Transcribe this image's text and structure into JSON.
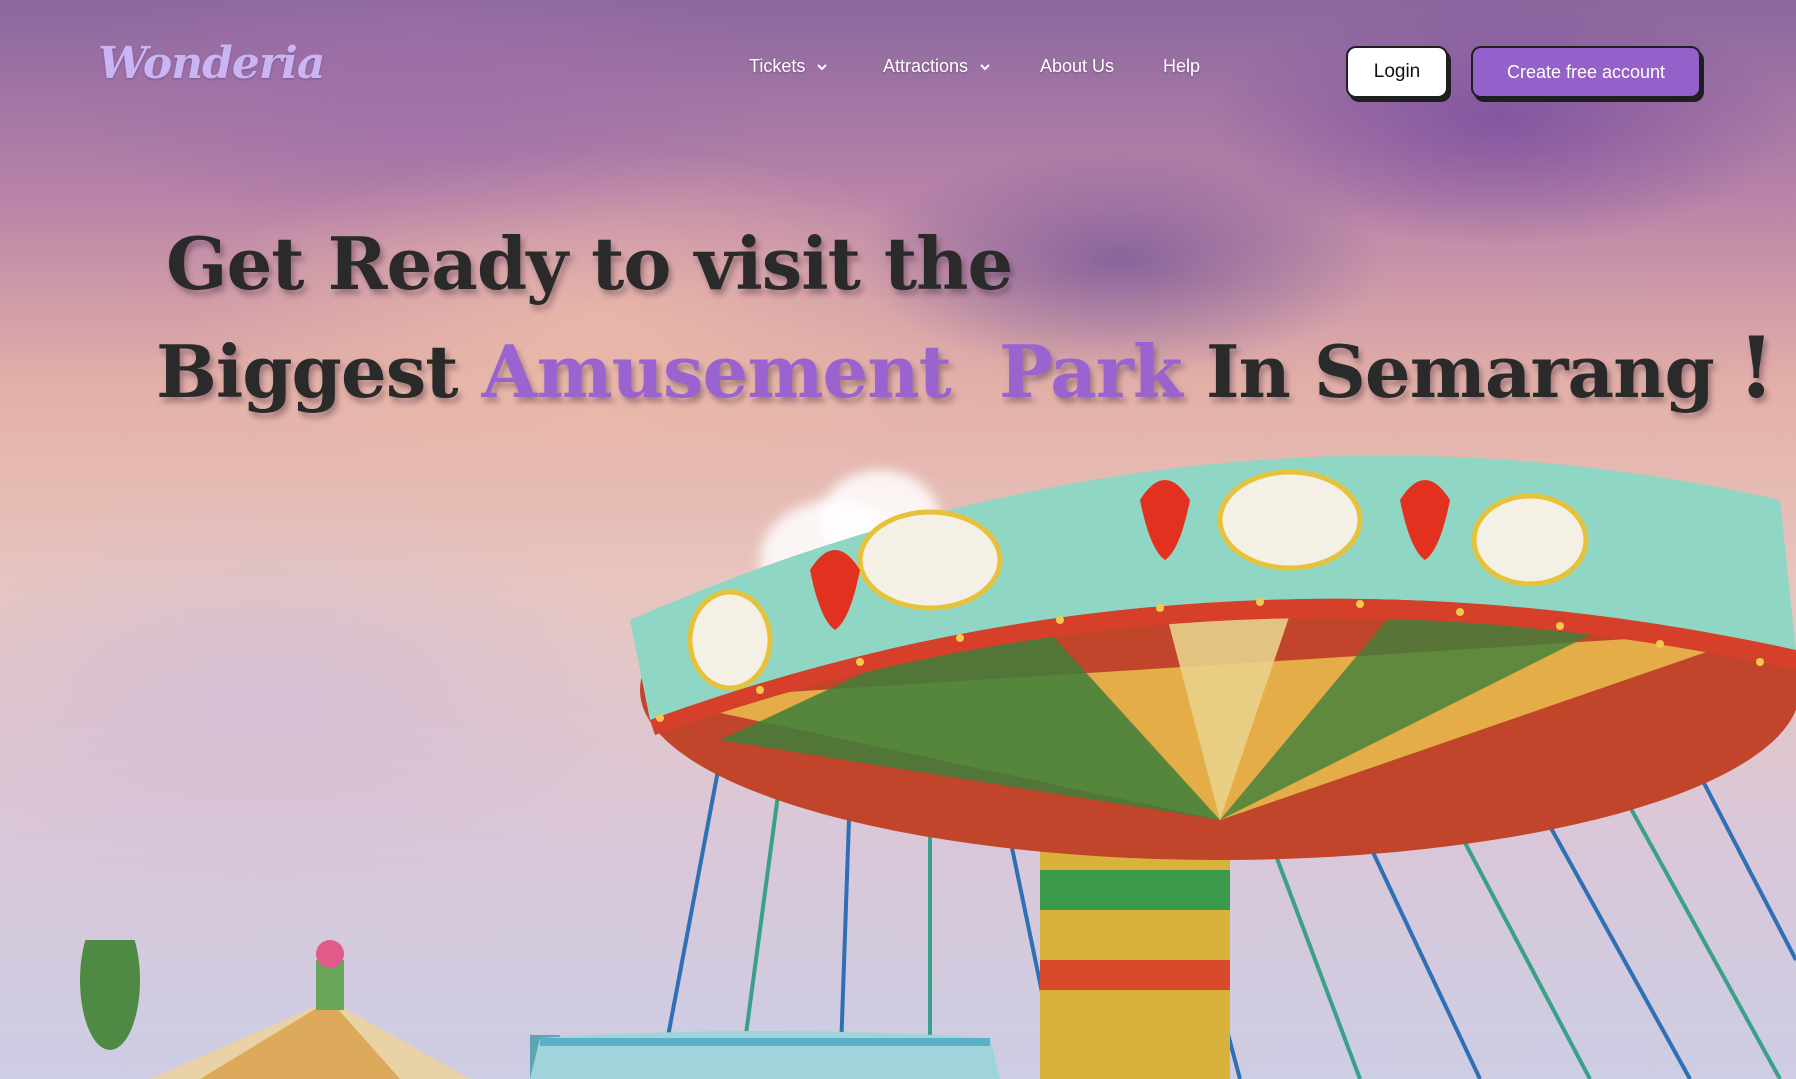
{
  "brand": {
    "logo_text": "Wonderia"
  },
  "nav": {
    "items": [
      {
        "label": "Tickets",
        "has_dropdown": true
      },
      {
        "label": "Attractions",
        "has_dropdown": true
      },
      {
        "label": "About Us",
        "has_dropdown": false
      },
      {
        "label": "Help",
        "has_dropdown": false
      }
    ]
  },
  "auth": {
    "login_label": "Login",
    "create_account_label": "Create free account"
  },
  "hero": {
    "line1": "Get Ready to visit the",
    "line2_start": "Biggest",
    "line2_accent": "Amusement  Park",
    "line2_end": "In Semarang",
    "exclamation": "! !"
  },
  "colors": {
    "accent": "#9460c9",
    "headline": "#2a2a2a",
    "logo": "#c9b5f3"
  },
  "icons": {
    "dropdown": "chevron-down-icon"
  }
}
